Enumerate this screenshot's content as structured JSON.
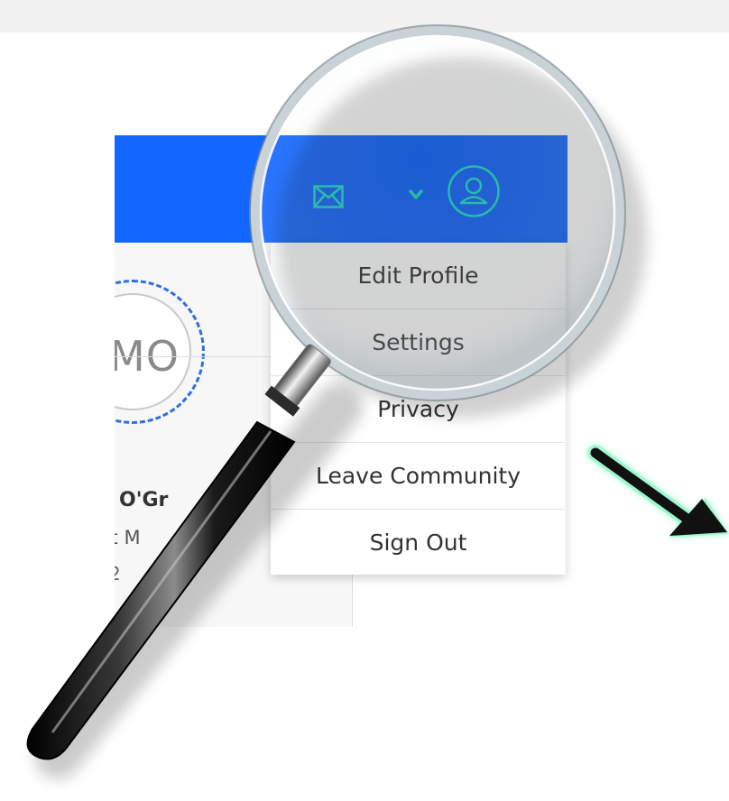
{
  "colors": {
    "brand_blue": "#1366ff",
    "icon_teal": "#1ee0c8",
    "ring_blue": "#2f6fe0",
    "arrow_glow": "#8ef7c9"
  },
  "header": {
    "icons": [
      {
        "name": "mail-icon"
      },
      {
        "name": "chevron-down-icon"
      },
      {
        "name": "user-icon"
      }
    ]
  },
  "profile": {
    "initials": "MO",
    "name": "O'Gr",
    "role": "ct M",
    "meta": "2"
  },
  "dropdown": {
    "items": [
      {
        "label": "Edit Profile"
      },
      {
        "label": "Settings"
      },
      {
        "label": "Privacy"
      },
      {
        "label": "Leave Community"
      },
      {
        "label": "Sign Out"
      }
    ]
  },
  "overlay": {
    "magnifier_icon": "magnifying-glass",
    "arrow_icon": "arrow-down-right"
  }
}
